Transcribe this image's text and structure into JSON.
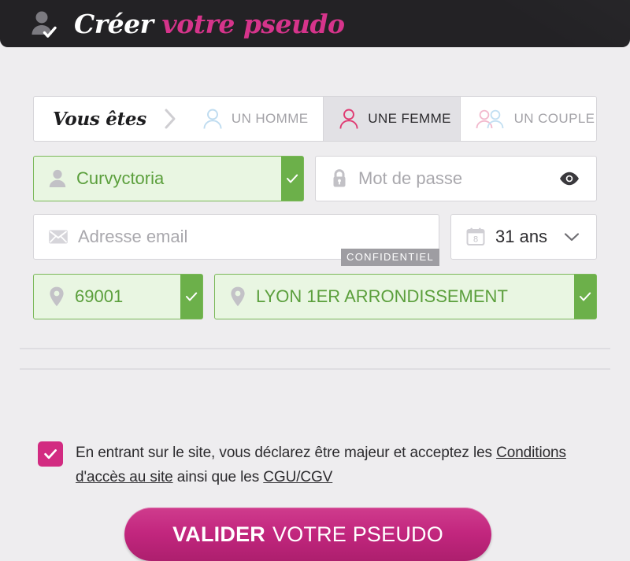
{
  "header": {
    "avatar_icon": "user-check-icon",
    "title_primary": "Créer",
    "title_secondary": "votre pseudo"
  },
  "gender_selector": {
    "label": "Vous êtes",
    "separator_icon": "chevron-right-icon",
    "options": [
      {
        "label": "UN HOMME",
        "icon": "male-person-icon",
        "selected": false
      },
      {
        "label": "UNE FEMME",
        "icon": "female-person-icon",
        "selected": true
      },
      {
        "label": "UN COUPLE",
        "icon": "couple-icon",
        "selected": false
      }
    ]
  },
  "form": {
    "username": {
      "icon": "user-icon",
      "value": "Curvyctoria",
      "state": "valid",
      "valid_icon": "check-icon"
    },
    "password": {
      "icon": "lock-icon",
      "placeholder": "Mot de passe",
      "value": "",
      "reveal_icon": "eye-icon"
    },
    "email": {
      "icon": "envelope-icon",
      "placeholder": "Adresse email",
      "value": "",
      "badge": "CONFIDENTIEL"
    },
    "age": {
      "icon": "calendar-icon",
      "calendar_day": "8",
      "value": "31 ans",
      "dropdown_icon": "chevron-down-icon"
    },
    "postal_code": {
      "icon": "location-pin-icon",
      "value": "69001",
      "state": "valid",
      "valid_icon": "check-icon"
    },
    "city": {
      "icon": "location-pin-icon",
      "value": "LYON 1ER ARRONDISSEMENT",
      "state": "valid",
      "valid_icon": "check-icon"
    }
  },
  "terms": {
    "checked": true,
    "check_icon": "check-icon",
    "text_part1": "En entrant sur le site, vous déclarez être majeur et acceptez les ",
    "link1": "Conditions d'accès au site",
    "text_part2": " ainsi que les ",
    "link2": "CGU/CGV"
  },
  "submit": {
    "label_strong": "VALIDER",
    "label_rest": "VOTRE PSEUDO"
  },
  "colors": {
    "brand_pink": "#d22b81",
    "header_dark": "#232225",
    "valid_green": "#6cb04a",
    "valid_green_bg": "#e9f6e2",
    "page_bg": "#eeedef"
  }
}
